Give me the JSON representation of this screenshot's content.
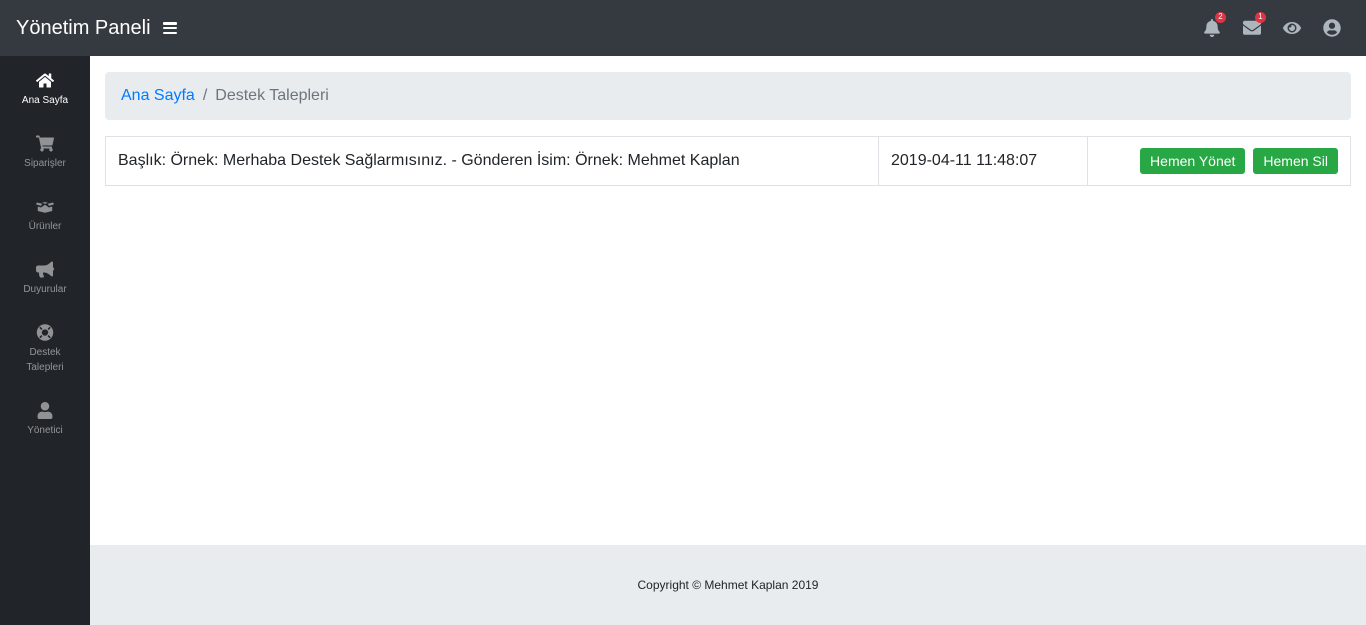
{
  "header": {
    "title": "Yönetim Paneli",
    "notifications_count": "2",
    "messages_count": "1",
    "icons": [
      "menu-icon",
      "bell-icon",
      "envelope-icon",
      "eye-icon",
      "user-circle-icon"
    ]
  },
  "sidebar": {
    "items": [
      {
        "label": "Ana Sayfa",
        "icon": "home-icon",
        "active": true
      },
      {
        "label": "Siparişler",
        "icon": "cart-icon"
      },
      {
        "label": "Ürünler",
        "icon": "boxes-icon"
      },
      {
        "label": "Duyurular",
        "icon": "bullhorn-icon"
      },
      {
        "label": "Destek Talepleri",
        "icon": "life-ring-icon"
      },
      {
        "label": "Yönetici",
        "icon": "user-icon"
      }
    ]
  },
  "breadcrumb": {
    "home": "Ana Sayfa",
    "separator": "/",
    "current": "Destek Talepleri"
  },
  "tickets": {
    "rows": [
      {
        "summary": "Başlık: Örnek: Merhaba Destek Sağlarmısınız. - Gönderen İsim: Örnek: Mehmet Kaplan",
        "date": "2019-04-11 11:48:07",
        "manage_label": "Hemen Yönet",
        "delete_label": "Hemen Sil"
      }
    ]
  },
  "footer": {
    "text": "Copyright © Mehmet Kaplan 2019"
  },
  "colors": {
    "topbar": "#343a40",
    "sidebar": "#212529",
    "link": "#007bff",
    "button": "#28a745",
    "badge": "#dc3545"
  }
}
